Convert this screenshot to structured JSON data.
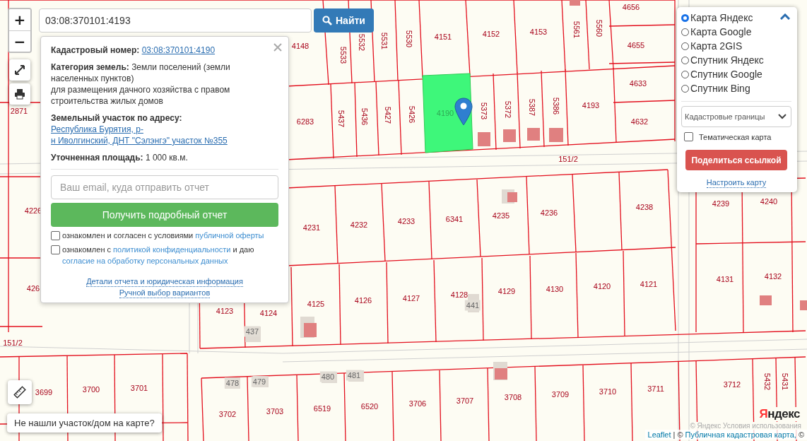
{
  "search": {
    "value": "03:08:370101:4193",
    "button": "Найти"
  },
  "zoom": {
    "in": "+",
    "out": "−"
  },
  "parcels": [
    {
      "label": "4148",
      "kind": "flat"
    },
    {
      "label": "5533",
      "kind": "rotated"
    },
    {
      "label": "5532",
      "kind": "rotated"
    },
    {
      "label": "5531",
      "kind": "rotated"
    },
    {
      "label": "5530",
      "kind": "rotated"
    },
    {
      "label": "4151",
      "kind": "flat"
    },
    {
      "label": "4152",
      "kind": "flat"
    },
    {
      "label": "4153",
      "kind": "flat"
    },
    {
      "label": "5561",
      "kind": "rotated"
    },
    {
      "label": "5560",
      "kind": "rotated"
    },
    {
      "label": "4656",
      "kind": "flat"
    },
    {
      "label": "4655",
      "kind": "flat"
    },
    {
      "label": "4633",
      "kind": "flat"
    },
    {
      "label": "4632",
      "kind": "flat"
    },
    {
      "label": "4193",
      "kind": "flat"
    },
    {
      "label": "2871",
      "kind": "flat"
    },
    {
      "label": "6283",
      "kind": "flat"
    },
    {
      "label": "5437",
      "kind": "rotated"
    },
    {
      "label": "5436",
      "kind": "rotated"
    },
    {
      "label": "5427",
      "kind": "rotated"
    },
    {
      "label": "5426",
      "kind": "rotated"
    },
    {
      "label": "4190",
      "kind": "selected"
    },
    {
      "label": "5373",
      "kind": "rotated"
    },
    {
      "label": "5372",
      "kind": "rotated"
    },
    {
      "label": "5387",
      "kind": "rotated"
    },
    {
      "label": "5386",
      "kind": "rotated"
    },
    {
      "label": "151/2",
      "kind": "road"
    },
    {
      "label": "4226",
      "kind": "flat"
    },
    {
      "label": "4231",
      "kind": "flat"
    },
    {
      "label": "4232",
      "kind": "flat"
    },
    {
      "label": "4233",
      "kind": "flat"
    },
    {
      "label": "6341",
      "kind": "flat"
    },
    {
      "label": "4235",
      "kind": "flat"
    },
    {
      "label": "4236",
      "kind": "flat"
    },
    {
      "label": "4238",
      "kind": "flat"
    },
    {
      "label": "4239",
      "kind": "flat"
    },
    {
      "label": "4240",
      "kind": "flat"
    },
    {
      "label": "426",
      "kind": "flat"
    },
    {
      "label": "4123",
      "kind": "flat"
    },
    {
      "label": "4124",
      "kind": "flat"
    },
    {
      "label": "4125",
      "kind": "flat"
    },
    {
      "label": "4126",
      "kind": "flat"
    },
    {
      "label": "4127",
      "kind": "flat"
    },
    {
      "label": "4128",
      "kind": "flat"
    },
    {
      "label": "441",
      "kind": "house"
    },
    {
      "label": "4129",
      "kind": "flat"
    },
    {
      "label": "4130",
      "kind": "flat"
    },
    {
      "label": "4120",
      "kind": "flat"
    },
    {
      "label": "4121",
      "kind": "flat"
    },
    {
      "label": "4131",
      "kind": "flat"
    },
    {
      "label": "4132",
      "kind": "flat"
    },
    {
      "label": "437",
      "kind": "house"
    },
    {
      "label": "151/2",
      "kind": "road"
    },
    {
      "label": "478",
      "kind": "house"
    },
    {
      "label": "479",
      "kind": "house"
    },
    {
      "label": "480",
      "kind": "house"
    },
    {
      "label": "481",
      "kind": "house"
    },
    {
      "label": "3699",
      "kind": "flat"
    },
    {
      "label": "3700",
      "kind": "flat"
    },
    {
      "label": "3701",
      "kind": "flat"
    },
    {
      "label": "3702",
      "kind": "flat"
    },
    {
      "label": "3703",
      "kind": "flat"
    },
    {
      "label": "6519",
      "kind": "flat"
    },
    {
      "label": "6520",
      "kind": "flat"
    },
    {
      "label": "3706",
      "kind": "flat"
    },
    {
      "label": "3707",
      "kind": "flat"
    },
    {
      "label": "3708",
      "kind": "flat"
    },
    {
      "label": "3709",
      "kind": "flat"
    },
    {
      "label": "3710",
      "kind": "flat"
    },
    {
      "label": "3711",
      "kind": "flat"
    },
    {
      "label": "3712",
      "kind": "flat"
    },
    {
      "label": "5432",
      "kind": "rotated"
    },
    {
      "label": "5431",
      "kind": "rotated"
    }
  ],
  "popup": {
    "fields": [
      {
        "label": "Кадастровый номер:",
        "kind": "link",
        "lines": [
          "03:08:370101:4190"
        ]
      },
      {
        "label": "Категория земель:",
        "kind": "text",
        "lines": [
          "Земли поселений (земли населенных пунктов)",
          "для размещения дачного хозяйства с правом строительства жилых домов"
        ]
      },
      {
        "label": "Земельный участок по адресу:",
        "kind": "link",
        "lines": [
          "Республика Бурятия, р-",
          "н Иволгинский, ДНТ \"Сэлэнгэ\" участок №355"
        ]
      },
      {
        "label": "Уточненная площадь:",
        "kind": "text",
        "lines": [
          "1 000 кв.м."
        ]
      }
    ],
    "email_placeholder": "Ваш email, куда отправить отчет",
    "report_button": "Получить подробный отчет",
    "agreements": [
      {
        "checked": false,
        "parts": [
          {
            "kind": "text",
            "text": "ознакомлен и согласен с условиями"
          },
          {
            "kind": "link",
            "text": "публичной оферты"
          }
        ]
      },
      {
        "checked": false,
        "parts": [
          {
            "kind": "text",
            "text": "ознакомлен с"
          },
          {
            "kind": "link",
            "text": "политикой конфиденциальности"
          },
          {
            "kind": "text",
            "text": "и даю"
          },
          {
            "kind": "link",
            "text": "согласие на обработку персональных данных"
          }
        ]
      }
    ],
    "footer_links": [
      "Детали отчета и юридическая информация",
      "Ручной выбор вариантов"
    ]
  },
  "layers": {
    "items": [
      {
        "label": "Карта Яндекс",
        "selected": true
      },
      {
        "label": "Карта Google",
        "selected": false
      },
      {
        "label": "Карта 2GIS",
        "selected": false
      },
      {
        "label": "Спутник Яндекс",
        "selected": false
      },
      {
        "label": "Спутник Google",
        "selected": false
      },
      {
        "label": "Спутник Bing",
        "selected": false
      }
    ],
    "expanded": true,
    "overlay_select": "Кадастровые границы",
    "thematic": {
      "label": "Тематическая карта",
      "checked": false
    },
    "share_button": "Поделиться ссылкой",
    "settings_link": "Настроить карту"
  },
  "not_found_button": "Не нашли участок/дом на карте?",
  "provider_logo": "Яндекс",
  "provider_terms": "© Яндекс  Условия использования",
  "attribution": [
    {
      "kind": "link",
      "text": "Leaflet"
    },
    {
      "kind": "text",
      "text": "| ©"
    },
    {
      "kind": "link",
      "text": "Публичная кадастровая карта,"
    },
    {
      "kind": "text",
      "text": "©"
    }
  ]
}
